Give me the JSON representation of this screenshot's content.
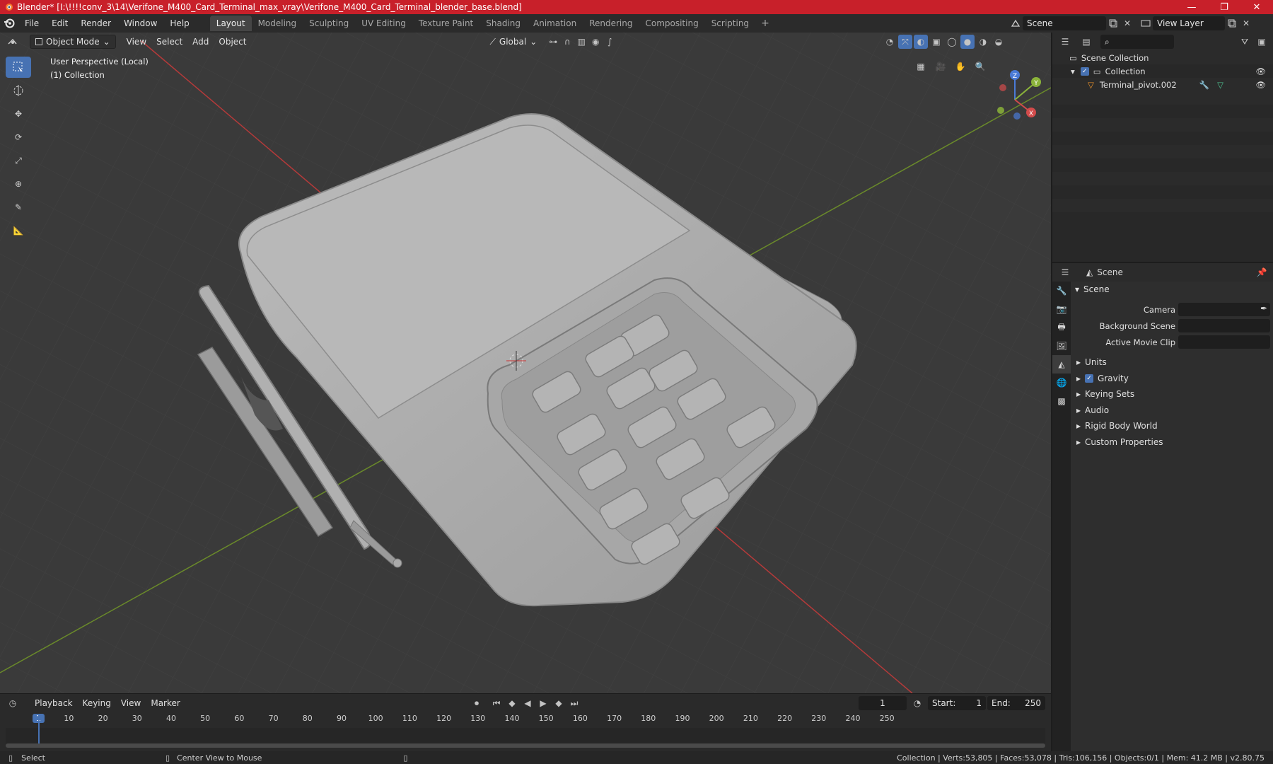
{
  "window": {
    "title": "Blender* [I:\\!!!!conv_3\\14\\Verifone_M400_Card_Terminal_max_vray\\Verifone_M400_Card_Terminal_blender_base.blend]",
    "minimize": "—",
    "maximize": "❐",
    "close": "✕"
  },
  "menu": {
    "items": [
      "File",
      "Edit",
      "Render",
      "Window",
      "Help"
    ]
  },
  "workspaces": {
    "tabs": [
      "Layout",
      "Modeling",
      "Sculpting",
      "UV Editing",
      "Texture Paint",
      "Shading",
      "Animation",
      "Rendering",
      "Compositing",
      "Scripting"
    ],
    "active": "Layout",
    "add": "+"
  },
  "scene_selector": {
    "scene": "Scene",
    "view_layer": "View Layer"
  },
  "viewport": {
    "mode": "Object Mode",
    "menus": [
      "View",
      "Select",
      "Add",
      "Object"
    ],
    "orientation": "Global",
    "perspective_label": "User Perspective (Local)",
    "collection_label": "(1) Collection",
    "gizmo": {
      "x": "X",
      "y": "Y",
      "z": "Z"
    }
  },
  "outliner": {
    "search_placeholder": "",
    "rows": [
      {
        "label": "Scene Collection"
      },
      {
        "label": "Collection"
      },
      {
        "label": "Terminal_pivot.002"
      }
    ]
  },
  "properties": {
    "header_title": "Scene",
    "panel_title": "Scene",
    "fields": [
      {
        "label": "Camera"
      },
      {
        "label": "Background Scene"
      },
      {
        "label": "Active Movie Clip"
      }
    ],
    "subpanels": [
      "Units",
      "Gravity",
      "Keying Sets",
      "Audio",
      "Rigid Body World",
      "Custom Properties"
    ]
  },
  "timeline": {
    "menus": [
      "Playback",
      "Keying",
      "View",
      "Marker"
    ],
    "current_frame": "1",
    "start_label": "Start:",
    "start": "1",
    "end_label": "End:",
    "end": "250",
    "ruler": [
      "1",
      "10",
      "20",
      "30",
      "40",
      "50",
      "60",
      "70",
      "80",
      "90",
      "100",
      "110",
      "120",
      "130",
      "140",
      "150",
      "160",
      "170",
      "180",
      "190",
      "200",
      "210",
      "220",
      "230",
      "240",
      "250"
    ]
  },
  "statusbar": {
    "left": "Select",
    "middle": "Center View to Mouse",
    "right": "Collection | Verts:53,805 | Faces:53,078 | Tris:106,156 | Objects:0/1 | Mem: 41.2 MB | v2.80.75"
  },
  "colors": {
    "titlebar": "#c8202a",
    "accent": "#4772b3",
    "viewport_bg": "#393939",
    "x_axis": "#c43a3a",
    "y_axis": "#7aa52a"
  }
}
